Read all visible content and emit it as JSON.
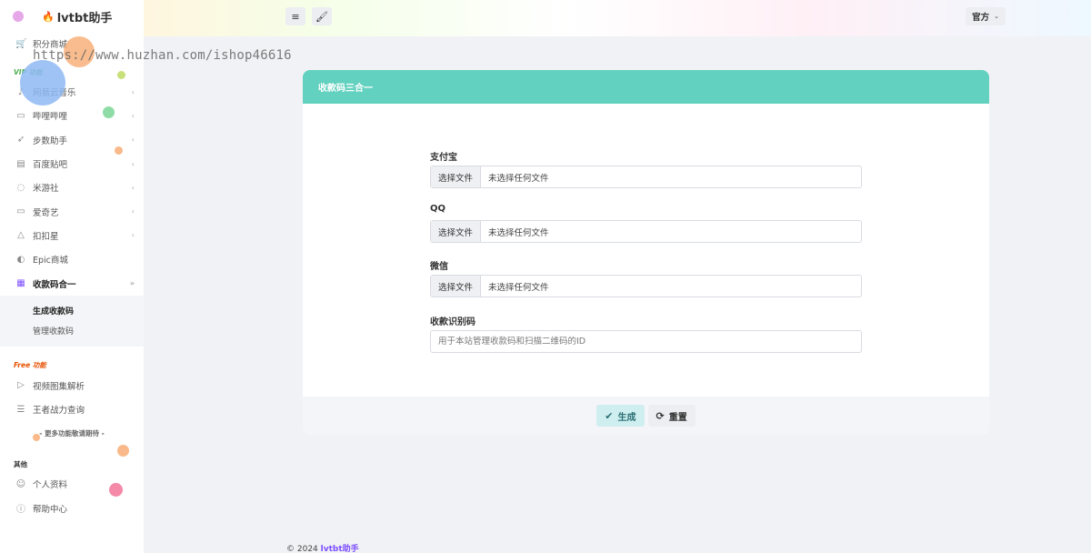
{
  "brand": {
    "name": "lvtbt助手"
  },
  "watermark": "https://www.huzhan.com/ishop46616",
  "sidebar": {
    "top_item": {
      "label": "积分商城",
      "icon": "cart-icon"
    },
    "vip_label": "VIP 功能",
    "vip_items": [
      {
        "label": "网易云音乐",
        "icon": "music-icon"
      },
      {
        "label": "哔哩哔哩",
        "icon": "video-icon"
      },
      {
        "label": "步数助手",
        "icon": "rocket-icon"
      },
      {
        "label": "百度贴吧",
        "icon": "book-icon"
      },
      {
        "label": "米游社",
        "icon": "bulb-icon"
      },
      {
        "label": "爱奇艺",
        "icon": "monitor-icon"
      },
      {
        "label": "扣扣星",
        "icon": "graduation-icon"
      },
      {
        "label": "Epic商城",
        "icon": "palette-icon"
      },
      {
        "label": "收款码合一",
        "icon": "qrcode-icon"
      }
    ],
    "submenu": [
      {
        "label": "生成收款码"
      },
      {
        "label": "管理收款码"
      }
    ],
    "free_label": "Free 功能",
    "free_items": [
      {
        "label": "视频图集解析",
        "icon": "play-icon"
      },
      {
        "label": "王者战力查询",
        "icon": "list-icon"
      }
    ],
    "more_text": "- 更多功能敬请期待 -",
    "other_label": "其他",
    "other_items": [
      {
        "label": "个人资料",
        "icon": "user-icon"
      },
      {
        "label": "帮助中心",
        "icon": "info-icon"
      }
    ]
  },
  "header": {
    "menu_icon": "menu-icon",
    "theme_icon": "brush-icon",
    "user_label": "官方"
  },
  "card": {
    "title": "收款码三合一",
    "fields": [
      {
        "label": "支付宝",
        "button": "选择文件",
        "status": "未选择任何文件"
      },
      {
        "label": "QQ",
        "button": "选择文件",
        "status": "未选择任何文件"
      },
      {
        "label": "微信",
        "button": "选择文件",
        "status": "未选择任何文件"
      }
    ],
    "id_field": {
      "label": "收款识别码",
      "placeholder": "用于本站管理收款码和扫描二维码的ID"
    },
    "generate_label": "生成",
    "reset_label": "重置"
  },
  "footer": {
    "copyright": "© 2024",
    "brand": "lvtbt助手"
  },
  "colors": {
    "card_header": "#63d1bf",
    "brand_accent": "#7c4dff",
    "vip_label": "#4caf50",
    "free_label": "#e65100"
  }
}
